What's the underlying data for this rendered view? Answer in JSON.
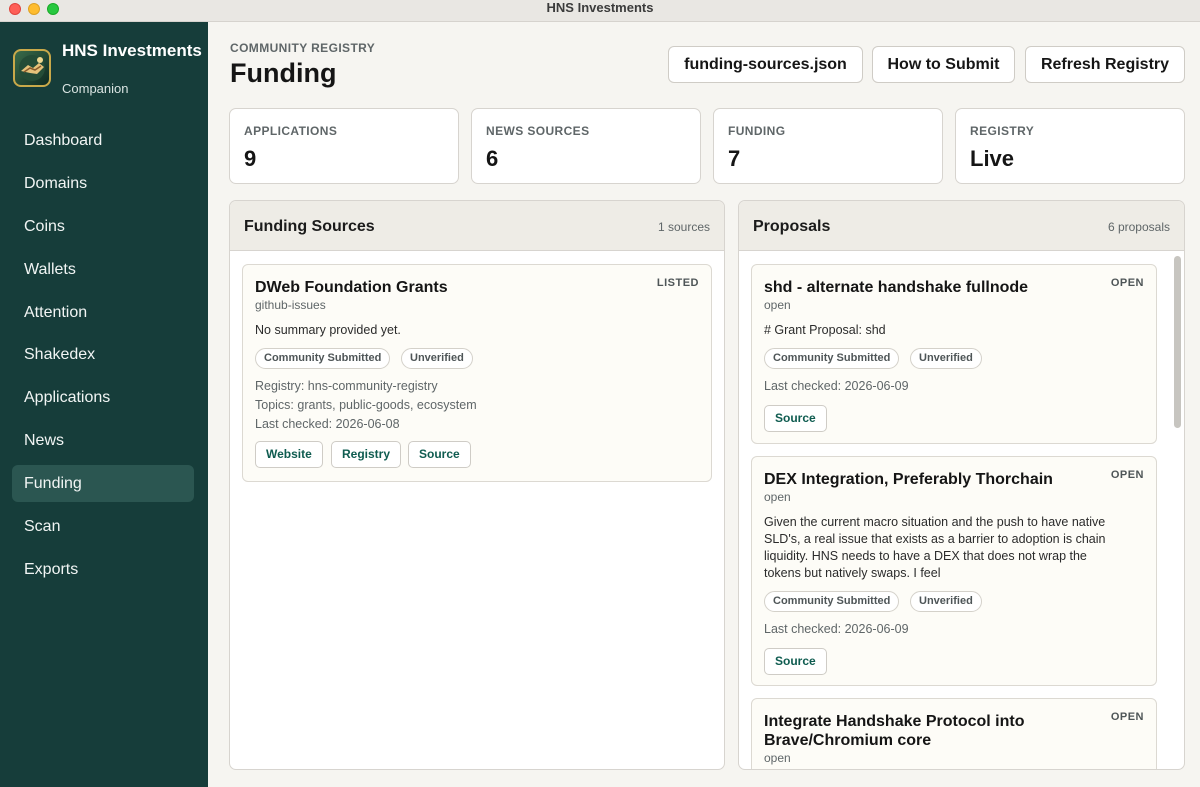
{
  "window": {
    "title": "HNS Investments"
  },
  "sidebar": {
    "brand_name": "HNS Investments",
    "brand_sub": "Companion",
    "items": [
      {
        "label": "Dashboard",
        "active": false
      },
      {
        "label": "Domains",
        "active": false
      },
      {
        "label": "Coins",
        "active": false
      },
      {
        "label": "Wallets",
        "active": false
      },
      {
        "label": "Attention",
        "active": false
      },
      {
        "label": "Shakedex",
        "active": false
      },
      {
        "label": "Applications",
        "active": false
      },
      {
        "label": "News",
        "active": false
      },
      {
        "label": "Funding",
        "active": true
      },
      {
        "label": "Scan",
        "active": false
      },
      {
        "label": "Exports",
        "active": false
      }
    ]
  },
  "header": {
    "eyebrow": "COMMUNITY REGISTRY",
    "title": "Funding",
    "buttons": {
      "json": "funding-sources.json",
      "submit": "How to Submit",
      "refresh": "Refresh Registry"
    }
  },
  "stats": [
    {
      "label": "APPLICATIONS",
      "value": "9"
    },
    {
      "label": "NEWS SOURCES",
      "value": "6"
    },
    {
      "label": "FUNDING",
      "value": "7"
    },
    {
      "label": "REGISTRY",
      "value": "Live"
    }
  ],
  "funding_panel": {
    "title": "Funding Sources",
    "count": "1 sources",
    "cards": [
      {
        "title": "DWeb Foundation Grants",
        "badge": "LISTED",
        "sub": "github-issues",
        "summary": "No summary provided yet.",
        "tags": [
          "Community Submitted",
          "Unverified"
        ],
        "registry": "Registry: hns-community-registry",
        "topics": "Topics: grants, public-goods, ecosystem",
        "checked": "Last checked: 2026-06-08",
        "buttons": [
          "Website",
          "Registry",
          "Source"
        ]
      }
    ]
  },
  "proposals_panel": {
    "title": "Proposals",
    "count": "6 proposals",
    "cards": [
      {
        "title": "shd - alternate handshake fullnode",
        "badge": "OPEN",
        "sub": "open",
        "summary": "# Grant Proposal: shd",
        "tags": [
          "Community Submitted",
          "Unverified"
        ],
        "checked": "Last checked: 2026-06-09",
        "buttons": [
          "Source"
        ]
      },
      {
        "title": "DEX Integration, Preferably Thorchain",
        "badge": "OPEN",
        "sub": "open",
        "summary_lines": [
          "Given the current macro situation and the push to have native",
          "SLD's, a real issue that exists as a barrier to adoption is chain",
          "liquidity. HNS needs to have a DEX that does not wrap the",
          "tokens but natively swaps. I feel"
        ],
        "tags": [
          "Community Submitted",
          "Unverified"
        ],
        "checked": "Last checked: 2026-06-09",
        "buttons": [
          "Source"
        ]
      },
      {
        "title_lines": [
          "Integrate Handshake Protocol into",
          "Brave/Chromium core"
        ],
        "badge": "OPEN",
        "sub": "open"
      }
    ]
  },
  "colors": {
    "sidebar_bg": "#163d3a",
    "sidebar_active": "#2b5651",
    "accent_link": "#0f5c50",
    "page_bg": "#f6f5f1"
  }
}
